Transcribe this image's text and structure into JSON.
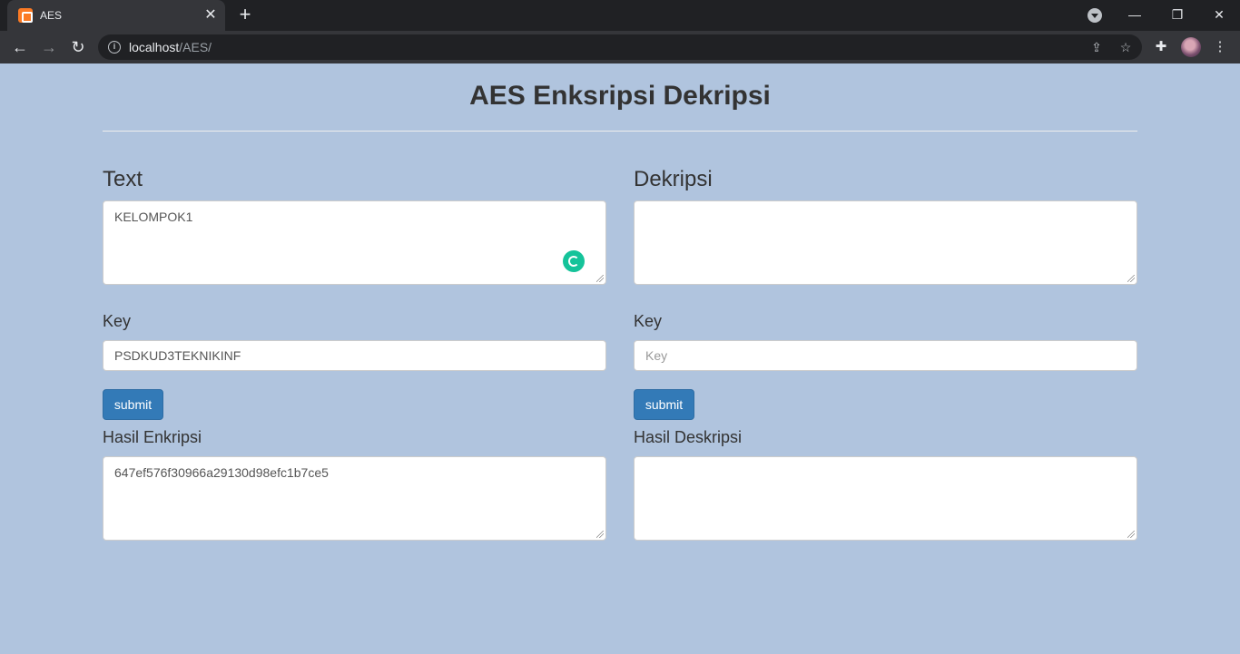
{
  "browser": {
    "tab_title": "AES",
    "url_host": "localhost",
    "url_path": "/AES/"
  },
  "page": {
    "title": "AES Enksripsi Dekripsi"
  },
  "encrypt": {
    "heading": "Text",
    "text_value": "KELOMPOK1",
    "key_label": "Key",
    "key_value": "PSDKUD3TEKNIKINF",
    "submit_label": "submit",
    "result_label": "Hasil Enkripsi",
    "result_value": "647ef576f30966a29130d98efc1b7ce5"
  },
  "decrypt": {
    "heading": "Dekripsi",
    "text_value": "",
    "key_label": "Key",
    "key_placeholder": "Key",
    "submit_label": "submit",
    "result_label": "Hasil Deskripsi",
    "result_value": ""
  },
  "colors": {
    "page_background": "#b0c4de",
    "button_primary": "#337ab7",
    "grammar_icon": "#15c39a"
  }
}
